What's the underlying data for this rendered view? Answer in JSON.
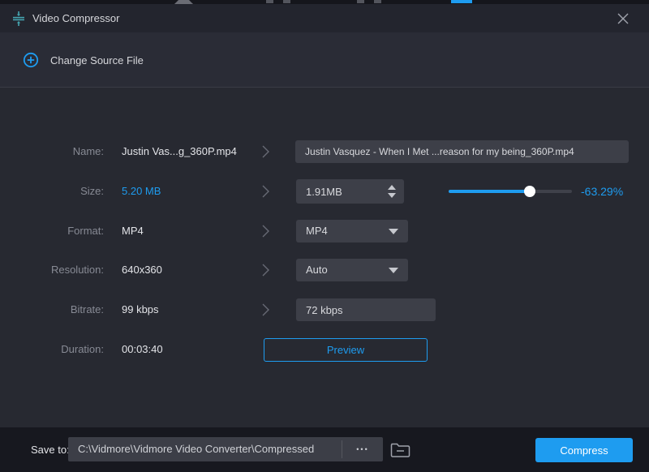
{
  "colors": {
    "accent": "#1e9cf0",
    "titlebar_icon": "#45a6b2"
  },
  "titlebar": {
    "title": "Video Compressor"
  },
  "header": {
    "change_source_label": "Change Source File"
  },
  "form": {
    "rows": [
      {
        "label": "Name:",
        "current": "Justin Vas...g_360P.mp4",
        "field_value": "Justin Vasquez - When I Met ...reason for my being_360P.mp4"
      },
      {
        "label": "Size:",
        "current": "5.20 MB",
        "field_value": "1.91MB",
        "reduction": "-63.29%"
      },
      {
        "label": "Format:",
        "current": "MP4",
        "field_value": "MP4"
      },
      {
        "label": "Resolution:",
        "current": "640x360",
        "field_value": "Auto"
      },
      {
        "label": "Bitrate:",
        "current": "99 kbps",
        "field_value": "72 kbps"
      },
      {
        "label": "Duration:",
        "current": "00:03:40",
        "button_label": "Preview"
      }
    ],
    "slider": {
      "fill_percent": 66
    }
  },
  "footer": {
    "save_to_label": "Save to:",
    "path": "C:\\Vidmore\\Vidmore Video Converter\\Compressed",
    "more_label": "•••",
    "compress_label": "Compress"
  }
}
